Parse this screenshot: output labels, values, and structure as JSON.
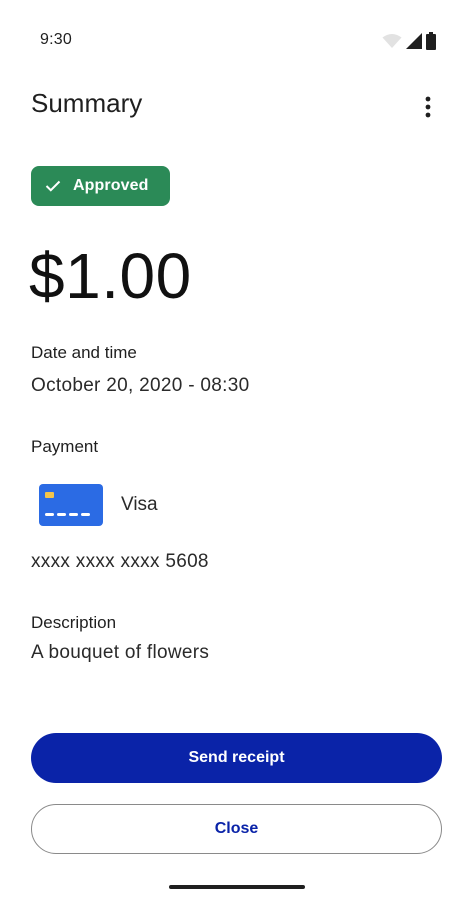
{
  "status_bar": {
    "time": "9:30",
    "icons": [
      "wifi-icon",
      "cellular-signal-icon",
      "battery-icon"
    ]
  },
  "app_bar": {
    "title": "Summary",
    "overflow_icon": "more-vert-icon"
  },
  "transaction": {
    "status": "Approved",
    "status_icon": "check-icon",
    "amount": "$1.00"
  },
  "details": {
    "date_label": "Date and time",
    "date_value": "October 20, 2020 - 08:30",
    "payment_label": "Payment",
    "card_icon": "credit-card-icon",
    "card_brand": "Visa",
    "card_number": "xxxx xxxx xxxx 5608",
    "description_label": "Description",
    "description_value": "A bouquet of flowers"
  },
  "actions": {
    "send_receipt": "Send receipt",
    "close": "Close"
  },
  "colors": {
    "badge_green": "#2b8a57",
    "primary_blue": "#0a23a8",
    "card_blue": "#2b6be4",
    "card_chip": "#f3c44a"
  }
}
